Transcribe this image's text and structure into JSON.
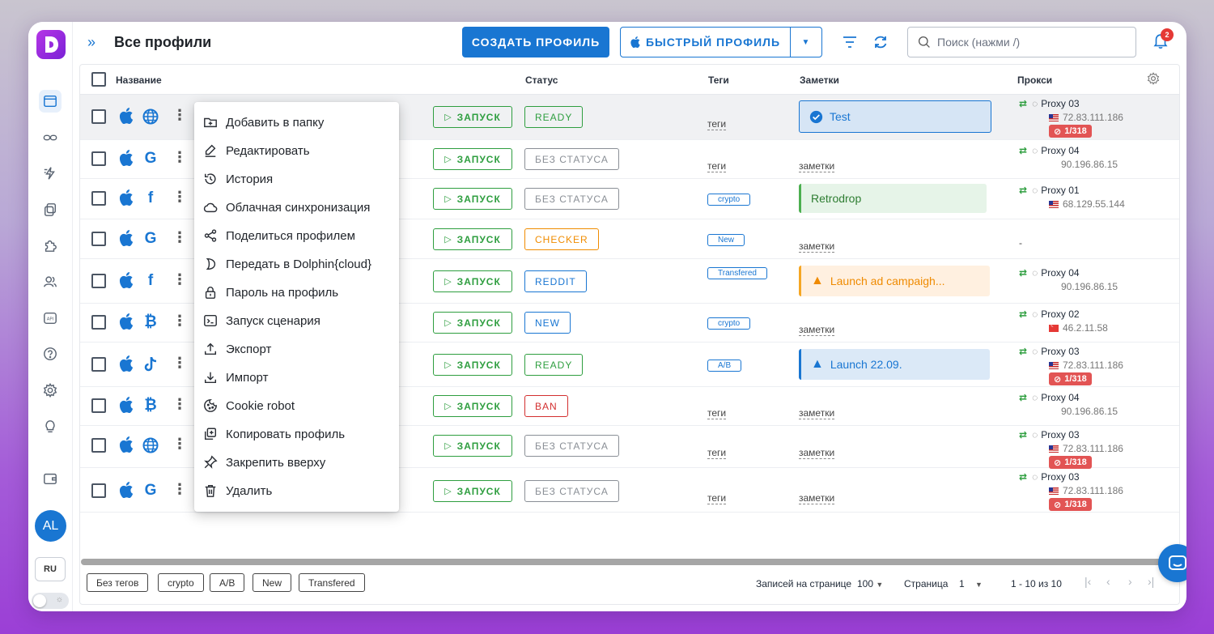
{
  "header": {
    "title": "Все профили",
    "create_label": "СОЗДАТЬ ПРОФИЛЬ",
    "quick_label": "БЫСТРЫЙ ПРОФИЛЬ",
    "search_placeholder": "Поиск (нажми /)",
    "notifications_count": "2"
  },
  "sidebar": {
    "avatar_initials": "AL",
    "language": "RU"
  },
  "table": {
    "columns": {
      "name": "Название",
      "status": "Статус",
      "tags": "Теги",
      "notes": "Заметки",
      "proxy": "Прокси"
    },
    "launch_label": "ЗАПУСК",
    "rows": [
      {
        "browser": "globe",
        "status": "READY",
        "tags": "теги",
        "tag_type": "link",
        "note": "Test",
        "note_type": "info",
        "proxy": "Proxy 03",
        "ip": "72.83.111.186",
        "flag": "us",
        "badge": "1/318"
      },
      {
        "browser": "G",
        "status": "БЕЗ СТАТУСА",
        "tags": "теги",
        "tag_type": "link",
        "note": "заметки",
        "note_type": "link",
        "proxy": "Proxy 04",
        "ip": "90.196.86.15",
        "flag": "none",
        "badge": ""
      },
      {
        "browser": "f",
        "status": "БЕЗ СТАТУСА",
        "tags": "crypto",
        "tag_type": "chip",
        "note": "Retrodrop",
        "note_type": "green",
        "proxy": "Proxy 01",
        "ip": "68.129.55.144",
        "flag": "us",
        "badge": ""
      },
      {
        "browser": "G",
        "status": "CHECKER",
        "tags": "New",
        "tag_type": "chip",
        "note": "заметки",
        "note_type": "link",
        "proxy": "-",
        "ip": "",
        "flag": "none",
        "badge": ""
      },
      {
        "browser": "f",
        "status": "REDDIT",
        "tags": "Transfered",
        "tag_type": "chip",
        "note": "Launch ad campaigh...",
        "note_type": "warning",
        "proxy": "Proxy 04",
        "ip": "90.196.86.15",
        "flag": "none",
        "badge": ""
      },
      {
        "browser": "B",
        "status": "NEW",
        "tags": "crypto",
        "tag_type": "chip",
        "note": "заметки",
        "note_type": "link",
        "proxy": "Proxy 02",
        "ip": "46.2.11.58",
        "flag": "tr",
        "badge": ""
      },
      {
        "browser": "tiktok",
        "status": "READY",
        "tags": "A/B",
        "tag_type": "chip",
        "note": "Launch 22.09.",
        "note_type": "infoalert",
        "proxy": "Proxy 03",
        "ip": "72.83.111.186",
        "flag": "us",
        "badge": "1/318"
      },
      {
        "browser": "B",
        "status": "BAN",
        "tags": "теги",
        "tag_type": "link",
        "note": "заметки",
        "note_type": "link",
        "proxy": "Proxy 04",
        "ip": "90.196.86.15",
        "flag": "none",
        "badge": ""
      },
      {
        "browser": "globe",
        "status": "БЕЗ СТАТУСА",
        "tags": "теги",
        "tag_type": "link",
        "note": "заметки",
        "note_type": "link",
        "proxy": "Proxy 03",
        "ip": "72.83.111.186",
        "flag": "us",
        "badge": "1/318"
      },
      {
        "browser": "G",
        "status": "БЕЗ СТАТУСА",
        "tags": "теги",
        "tag_type": "link",
        "note": "заметки",
        "note_type": "link",
        "proxy": "Proxy 03",
        "ip": "72.83.111.186",
        "flag": "us",
        "badge": "1/318"
      }
    ]
  },
  "status_colors": {
    "READY": "#2e9e3f",
    "БЕЗ СТАТУСА": "#8a8f96",
    "CHECKER": "#f08c00",
    "REDDIT": "#1976d2",
    "NEW": "#1976d2",
    "BAN": "#d32f2f"
  },
  "context_menu": [
    {
      "label": "Добавить в папку",
      "icon": "folder-plus-icon"
    },
    {
      "label": "Редактировать",
      "icon": "edit-icon"
    },
    {
      "label": "История",
      "icon": "history-icon"
    },
    {
      "label": "Облачная синхронизация",
      "icon": "cloud-icon"
    },
    {
      "label": "Поделиться профилем",
      "icon": "share-icon"
    },
    {
      "label": "Передать в Dolphin{cloud}",
      "icon": "dolphin-icon"
    },
    {
      "label": "Пароль на профиль",
      "icon": "lock-icon"
    },
    {
      "label": "Запуск сценария",
      "icon": "terminal-icon"
    },
    {
      "label": "Экспорт",
      "icon": "upload-icon"
    },
    {
      "label": "Импорт",
      "icon": "download-icon"
    },
    {
      "label": "Cookie robot",
      "icon": "cookie-icon"
    },
    {
      "label": "Копировать профиль",
      "icon": "copy-icon"
    },
    {
      "label": "Закрепить вверху",
      "icon": "pin-icon"
    },
    {
      "label": "Удалить",
      "icon": "trash-icon"
    }
  ],
  "footer": {
    "tags": [
      "Без тегов",
      "crypto",
      "A/B",
      "New",
      "Transfered"
    ],
    "per_page_label": "Записей на странице",
    "per_page_value": "100",
    "page_label": "Страница",
    "page_value": "1",
    "range": "1 - 10 из 10"
  },
  "colors": {
    "accent": "#1976d2",
    "launch": "#2e9e3f",
    "danger": "#e25454"
  }
}
